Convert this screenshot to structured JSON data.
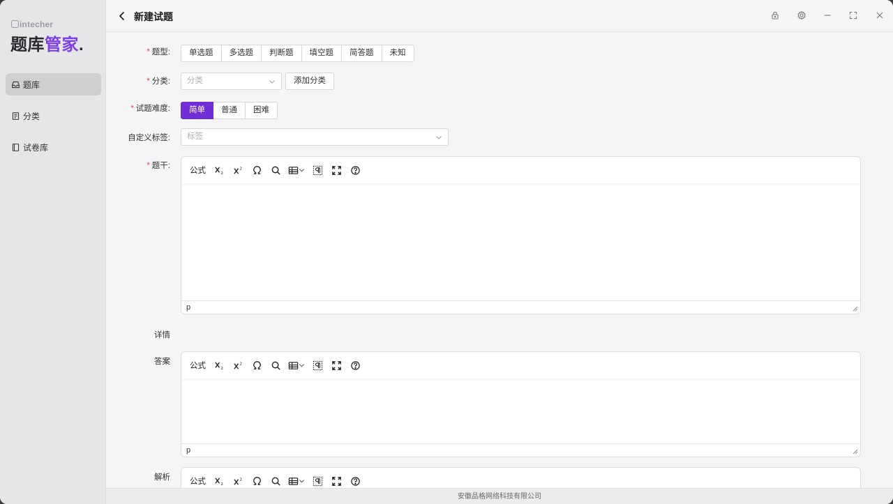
{
  "brand": {
    "small": "intecher",
    "name_a": "题库",
    "name_b": "管家",
    "dot": "."
  },
  "nav": [
    {
      "label": "题库",
      "icon": "inbox-icon",
      "active": true
    },
    {
      "label": "分类",
      "icon": "document-icon",
      "active": false
    },
    {
      "label": "试卷库",
      "icon": "book-icon",
      "active": false
    }
  ],
  "header": {
    "title": "新建试题",
    "controls": [
      "lock-icon",
      "settings-icon",
      "minimize-icon",
      "maximize-icon",
      "close-icon"
    ]
  },
  "form": {
    "type": {
      "label": "题型:",
      "options": [
        "单选题",
        "多选题",
        "判断题",
        "填空题",
        "简答题",
        "未知"
      ]
    },
    "category": {
      "label": "分类:",
      "placeholder": "分类",
      "add_button": "添加分类"
    },
    "difficulty": {
      "label": "试题难度:",
      "options": [
        "简单",
        "普通",
        "困难"
      ],
      "selected": "简单"
    },
    "tags": {
      "label": "自定义标签:",
      "placeholder": "标签"
    },
    "stem": {
      "label": "题干:",
      "status": "p"
    },
    "details": {
      "label": "详情"
    },
    "answer": {
      "label": "答案",
      "status": "p"
    },
    "analysis": {
      "label": "解析"
    }
  },
  "toolbar": {
    "formula": "公式"
  },
  "colors": {
    "accent": "#6f2ed6",
    "required": "#e5484d",
    "brand_accent": "#7b3fe4"
  },
  "footer": "安徽品格网络科技有限公司"
}
